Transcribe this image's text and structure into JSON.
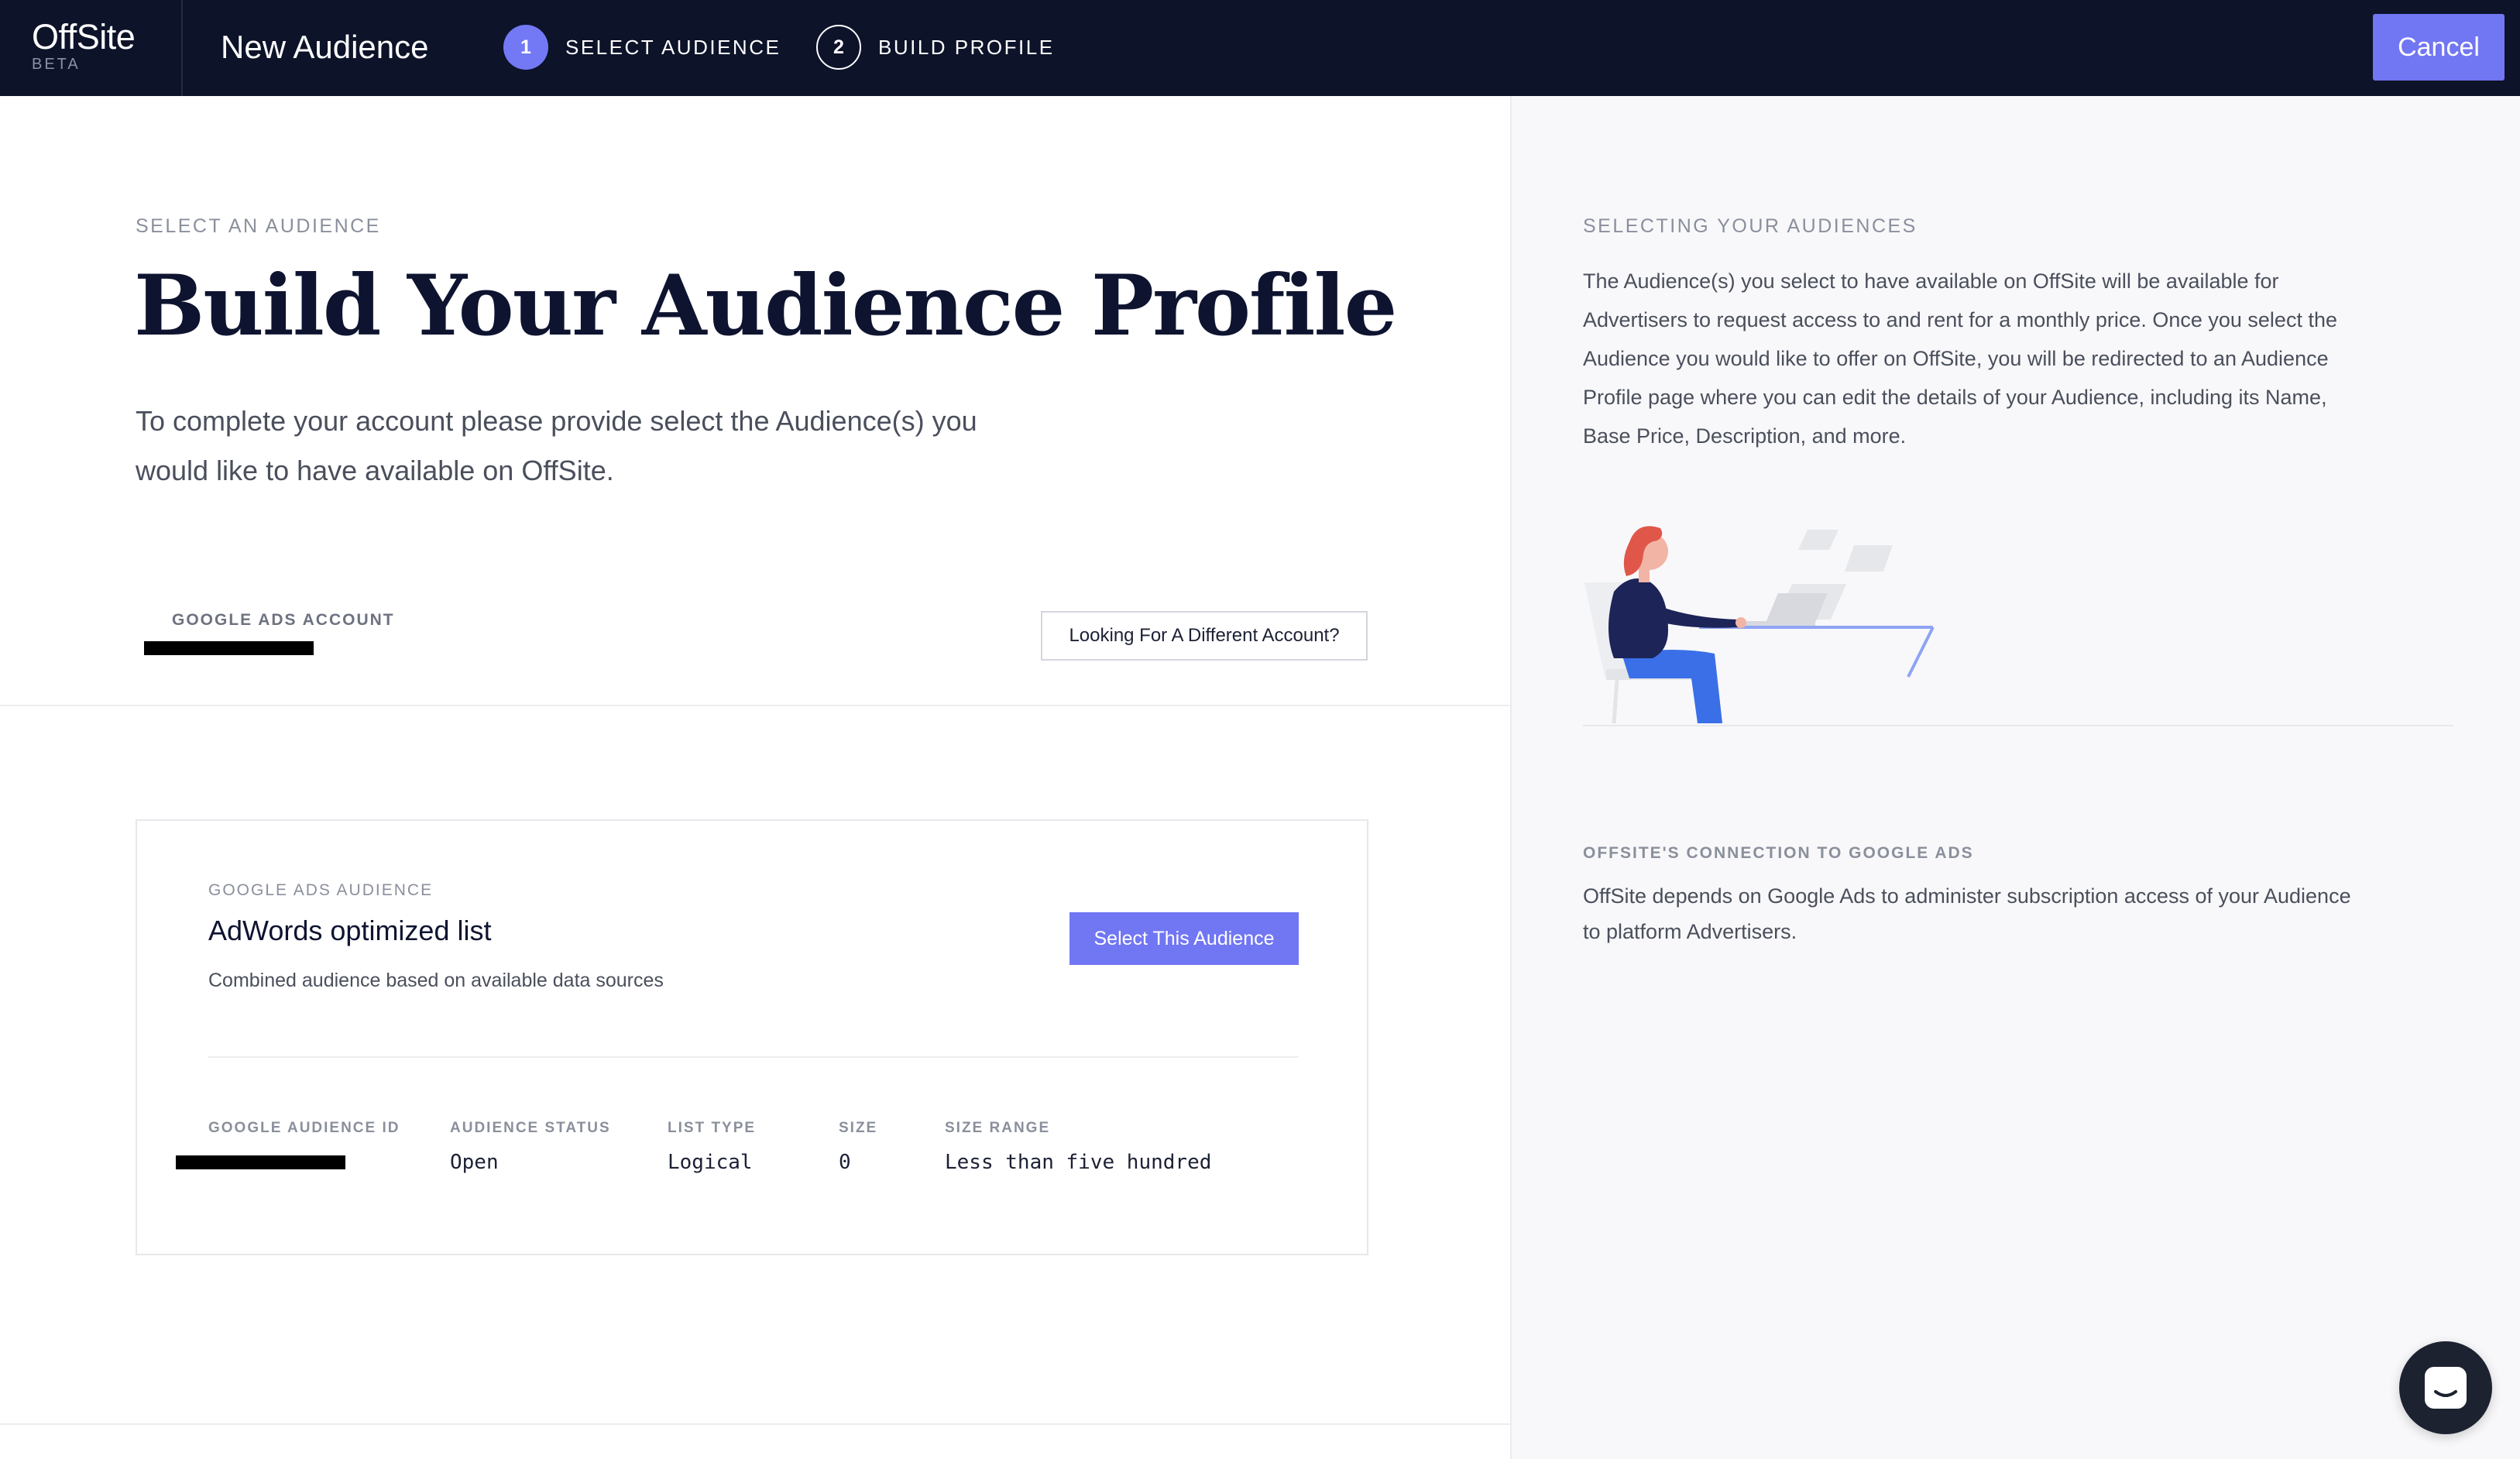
{
  "header": {
    "logo_name": "OffSite",
    "logo_tag": "BETA",
    "page_title": "New Audience",
    "steps": [
      {
        "number": "1",
        "label": "SELECT AUDIENCE",
        "active": true
      },
      {
        "number": "2",
        "label": "BUILD PROFILE",
        "active": false
      }
    ],
    "cancel_label": "Cancel"
  },
  "main": {
    "eyebrow": "SELECT AN AUDIENCE",
    "title": "Build Your Audience Profile",
    "intro": "To complete your account please provide select the Audience(s) you would like to have available on OffSite.",
    "account_label": "GOOGLE ADS ACCOUNT",
    "alt_account_button": "Looking For A Different Account?"
  },
  "audience_card": {
    "eyebrow": "GOOGLE ADS AUDIENCE",
    "title": "AdWords optimized list",
    "subtitle": "Combined audience based on available data sources",
    "select_button": "Select This Audience",
    "fields": [
      {
        "label": "GOOGLE AUDIENCE ID",
        "value": ""
      },
      {
        "label": "AUDIENCE STATUS",
        "value": "Open"
      },
      {
        "label": "LIST TYPE",
        "value": "Logical"
      },
      {
        "label": "SIZE",
        "value": "0"
      },
      {
        "label": "SIZE RANGE",
        "value": "Less than five hundred"
      }
    ]
  },
  "sidebar": {
    "section1_title": "SELECTING YOUR AUDIENCES",
    "section1_text": "The Audience(s) you select to have available on OffSite will be available for Advertisers to request access to and rent for a monthly price. Once you select the Audience you would like to offer on OffSite, you will be redirected to an Audience Profile page where you can edit the details of your Audience, including its Name, Base Price, Description, and more.",
    "section2_title": "OFFSITE'S CONNECTION TO GOOGLE ADS",
    "section2_text": "OffSite depends on Google Ads to administer subscription access of your Audience to platform Advertisers."
  },
  "colors": {
    "header_bg": "#0d1329",
    "accent": "#7176f3",
    "sidebar_bg": "#f8f8fa"
  },
  "icons": {
    "chat": "chat-bubble-icon",
    "illustration": "woman-at-laptop-illustration"
  }
}
